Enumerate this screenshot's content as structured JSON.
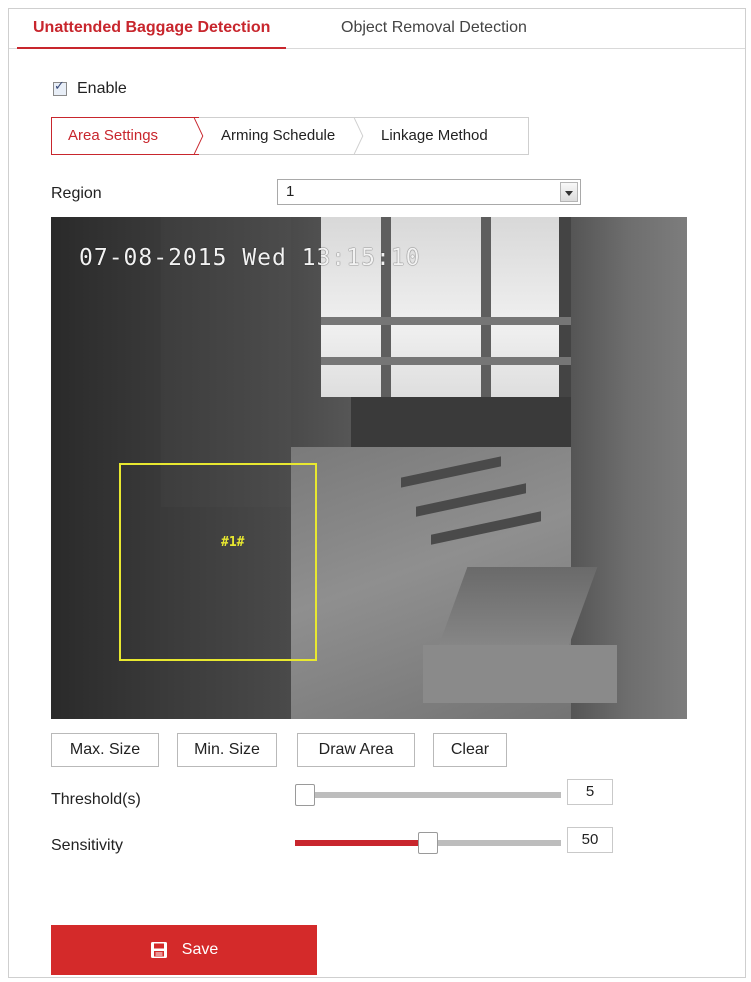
{
  "tabs": {
    "primary": "Unattended Baggage Detection",
    "secondary": "Object Removal Detection"
  },
  "enable": {
    "label": "Enable",
    "checked": true
  },
  "sub_tabs": {
    "area": "Area Settings",
    "schedule": "Arming Schedule",
    "linkage": "Linkage Method"
  },
  "region": {
    "label": "Region",
    "value": "1"
  },
  "video": {
    "timestamp": "07-08-2015 Wed 13:15:10",
    "area_label": "#1#"
  },
  "buttons": {
    "max_size": "Max. Size",
    "min_size": "Min. Size",
    "draw_area": "Draw Area",
    "clear": "Clear"
  },
  "threshold": {
    "label": "Threshold(s)",
    "value": "5",
    "level": 0.0
  },
  "sensitivity": {
    "label": "Sensitivity",
    "value": "50",
    "level": 0.5
  },
  "save": {
    "label": "Save"
  },
  "colors": {
    "accent": "#c8262d",
    "save_bg": "#d42a2a",
    "area_border": "#e8e830"
  }
}
